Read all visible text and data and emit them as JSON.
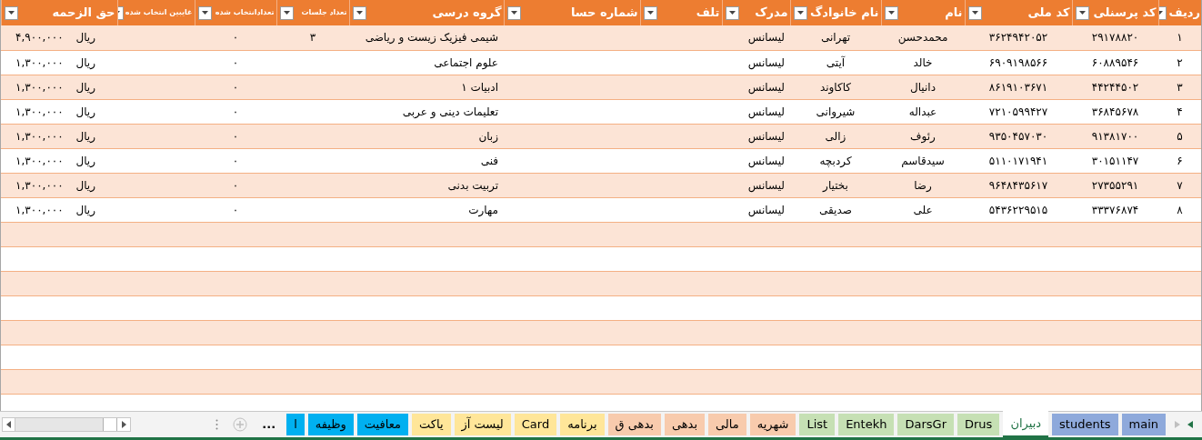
{
  "table": {
    "columns": [
      {
        "label": "ردیف"
      },
      {
        "label": "کد پرسنلی"
      },
      {
        "label": "کد ملی"
      },
      {
        "label": "نام"
      },
      {
        "label": "نام خانوادگ"
      },
      {
        "label": "مدرک"
      },
      {
        "label": "تلف"
      },
      {
        "label": "شماره حسا"
      },
      {
        "label": "گروه درسی"
      },
      {
        "label": "تعداد جلسات"
      },
      {
        "label": "تعدادانتخاب شده"
      },
      {
        "label": "غایبین انتخاب شده"
      },
      {
        "label": "حق الزحمه"
      }
    ],
    "rows": [
      {
        "cells": [
          "۱",
          "۲۹۱۷۸۸۲۰",
          "۳۶۲۴۹۴۲۰۵۲",
          "محمدحسن",
          "تهرانی",
          "لیسانس",
          null,
          null,
          "شیمی فیزیک زیست و ریاضی",
          "۳",
          "۰",
          null
        ],
        "currency": "ریال",
        "amount": "۴,۹۰۰,۰۰۰"
      },
      {
        "cells": [
          "۲",
          "۶۰۸۸۹۵۴۶",
          "۶۹۰۹۱۹۸۵۶۶",
          "خالد",
          "آیتی",
          "لیسانس",
          null,
          null,
          "علوم اجتماعی",
          null,
          "۰",
          null
        ],
        "currency": "ریال",
        "amount": "۱,۳۰۰,۰۰۰"
      },
      {
        "cells": [
          "۳",
          "۴۴۲۴۴۵۰۲",
          "۸۶۱۹۱۰۳۶۷۱",
          "دانیال",
          "کاکاوند",
          "لیسانس",
          null,
          null,
          "ادبیات ۱",
          null,
          "۰",
          null
        ],
        "currency": "ریال",
        "amount": "۱,۳۰۰,۰۰۰"
      },
      {
        "cells": [
          "۴",
          "۳۶۸۴۵۶۷۸",
          "۷۲۱۰۵۹۹۴۲۷",
          "عبداله",
          "شیروانی",
          "لیسانس",
          null,
          null,
          "تعلیمات دینی و عربی",
          null,
          "۰",
          null
        ],
        "currency": "ریال",
        "amount": "۱,۳۰۰,۰۰۰"
      },
      {
        "cells": [
          "۵",
          "۹۱۳۸۱۷۰۰",
          "۹۳۵۰۴۵۷۰۳۰",
          "رئوف",
          "زالی",
          "لیسانس",
          null,
          null,
          "زبان",
          null,
          "۰",
          null
        ],
        "currency": "ریال",
        "amount": "۱,۳۰۰,۰۰۰"
      },
      {
        "cells": [
          "۶",
          "۳۰۱۵۱۱۴۷",
          "۵۱۱۰۱۷۱۹۴۱",
          "سیدقاسم",
          "کردبچه",
          "لیسانس",
          null,
          null,
          "فنی",
          null,
          "۰",
          null
        ],
        "currency": "ریال",
        "amount": "۱,۳۰۰,۰۰۰"
      },
      {
        "cells": [
          "۷",
          "۲۷۳۵۵۲۹۱",
          "۹۶۴۸۴۳۵۶۱۷",
          "رضا",
          "بختیار",
          "لیسانس",
          null,
          null,
          "تربیت بدنی",
          null,
          "۰",
          null
        ],
        "currency": "ریال",
        "amount": "۱,۳۰۰,۰۰۰"
      },
      {
        "cells": [
          "۸",
          "۳۳۳۷۶۸۷۴",
          "۵۴۳۶۲۲۹۵۱۵",
          "علی",
          "صدیقی",
          "لیسانس",
          null,
          null,
          "مهارت",
          null,
          "۰",
          null
        ],
        "currency": "ریال",
        "amount": "۱,۳۰۰,۰۰۰"
      }
    ]
  },
  "sheet_tabs": [
    {
      "label": "main",
      "color": "#8ea9db",
      "selected": false
    },
    {
      "label": "students",
      "color": "#8ea9db",
      "selected": false
    },
    {
      "label": "دبیران",
      "color": "#ffffff",
      "selected": true
    },
    {
      "label": "Drus",
      "color": "#c6e0b4",
      "selected": false
    },
    {
      "label": "DarsGr",
      "color": "#c6e0b4",
      "selected": false
    },
    {
      "label": "Entekh",
      "color": "#c6e0b4",
      "selected": false
    },
    {
      "label": "List",
      "color": "#c6e0b4",
      "selected": false
    },
    {
      "label": "شهریه",
      "color": "#f8cbad",
      "selected": false
    },
    {
      "label": "مالی",
      "color": "#f8cbad",
      "selected": false
    },
    {
      "label": "بدهی",
      "color": "#f8cbad",
      "selected": false
    },
    {
      "label": "بدهی ق",
      "color": "#f8cbad",
      "selected": false
    },
    {
      "label": "برنامه",
      "color": "#ffe699",
      "selected": false
    },
    {
      "label": "Card",
      "color": "#ffe699",
      "selected": false
    },
    {
      "label": "لیست آز",
      "color": "#ffe699",
      "selected": false
    },
    {
      "label": "یاکت",
      "color": "#ffe699",
      "selected": false
    },
    {
      "label": "معافیت",
      "color": "#00b0f0",
      "selected": false
    },
    {
      "label": "وظیفه",
      "color": "#00b0f0",
      "selected": false
    },
    {
      "label": "ا",
      "color": "#00b0f0",
      "selected": false
    }
  ],
  "more_tabs": "..."
}
